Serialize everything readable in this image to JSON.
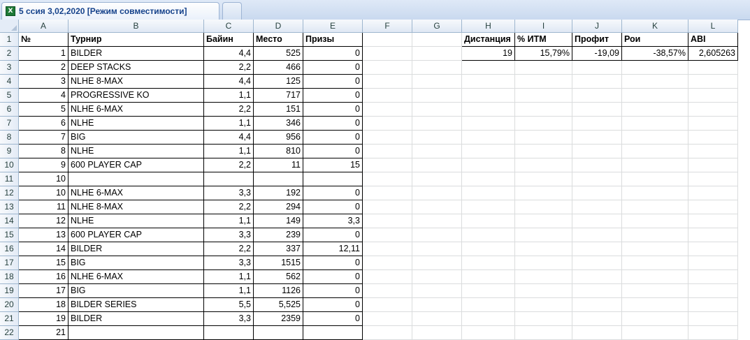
{
  "window": {
    "tab_title": "5 ссия 3,02,2020  [Режим совместимости]",
    "app_icon": "excel-workbook-icon"
  },
  "columns": [
    "A",
    "B",
    "C",
    "D",
    "E",
    "F",
    "G",
    "H",
    "I",
    "J",
    "K",
    "L"
  ],
  "rows": [
    "1",
    "2",
    "3",
    "4",
    "5",
    "6",
    "7",
    "8",
    "9",
    "10",
    "11",
    "12",
    "13",
    "14",
    "15",
    "16",
    "17",
    "18",
    "19",
    "20",
    "21",
    "22"
  ],
  "table": {
    "headers": [
      "№",
      "Турнир",
      "Байин",
      "Место",
      "Призы"
    ],
    "rows": [
      [
        "1",
        "BILDER",
        "4,4",
        "525",
        "0"
      ],
      [
        "2",
        "DEEP STACKS",
        "2,2",
        "466",
        "0"
      ],
      [
        "3",
        "NLHE 8-MAX",
        "4,4",
        "125",
        "0"
      ],
      [
        "4",
        "PROGRESSIVE KO",
        "1,1",
        "717",
        "0"
      ],
      [
        "5",
        "NLHE 6-MAX",
        "2,2",
        "151",
        "0"
      ],
      [
        "6",
        "NLHE",
        "1,1",
        "346",
        "0"
      ],
      [
        "7",
        "BIG",
        "4,4",
        "956",
        "0"
      ],
      [
        "8",
        "NLHE",
        "1,1",
        "810",
        "0"
      ],
      [
        "9",
        "600 PLAYER CAP",
        "2,2",
        "11",
        "15"
      ],
      [
        "10",
        "",
        "",
        "",
        ""
      ],
      [
        "10",
        "NLHE 6-MAX",
        "3,3",
        "192",
        "0"
      ],
      [
        "11",
        "NLHE 8-MAX",
        "2,2",
        "294",
        "0"
      ],
      [
        "12",
        "NLHE",
        "1,1",
        "149",
        "3,3"
      ],
      [
        "13",
        "600 PLAYER CAP",
        "3,3",
        "239",
        "0"
      ],
      [
        "14",
        "BILDER",
        "2,2",
        "337",
        "12,11"
      ],
      [
        "15",
        "BIG",
        "3,3",
        "1515",
        "0"
      ],
      [
        "16",
        "NLHE 6-MAX",
        "1,1",
        "562",
        "0"
      ],
      [
        "17",
        "BIG",
        "1,1",
        "1126",
        "0"
      ],
      [
        "18",
        "BILDER SERIES",
        "5,5",
        "5,525",
        "0"
      ],
      [
        "19",
        "BILDER",
        "3,3",
        "2359",
        "0"
      ],
      [
        "21",
        "",
        "",
        "",
        ""
      ]
    ]
  },
  "stats": {
    "headers": [
      "Дистанция",
      "% ИТМ",
      "Профит",
      "Рои",
      "ABI"
    ],
    "values": [
      "19",
      "15,79%",
      "-19,09",
      "-38,57%",
      "2,605263"
    ]
  }
}
